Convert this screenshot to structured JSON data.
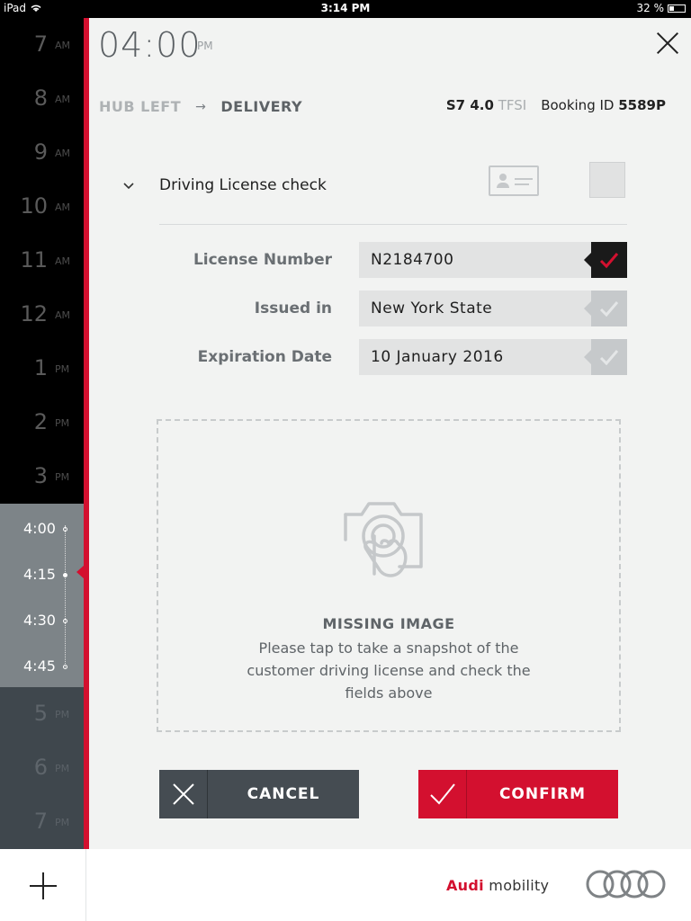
{
  "status_bar": {
    "device": "iPad",
    "time": "3:14 PM",
    "battery": "32 %"
  },
  "timeline": {
    "hours_before": [
      {
        "num": "7",
        "ampm": "AM"
      },
      {
        "num": "8",
        "ampm": "AM"
      },
      {
        "num": "9",
        "ampm": "AM"
      },
      {
        "num": "10",
        "ampm": "AM"
      },
      {
        "num": "11",
        "ampm": "AM"
      },
      {
        "num": "12",
        "ampm": "AM"
      },
      {
        "num": "1",
        "ampm": "PM"
      },
      {
        "num": "2",
        "ampm": "PM"
      },
      {
        "num": "3",
        "ampm": "PM"
      }
    ],
    "slots": [
      "4:00",
      "4:15",
      "4:30",
      "4:45"
    ],
    "hours_after": [
      {
        "num": "5",
        "ampm": "PM"
      },
      {
        "num": "6",
        "ampm": "PM"
      },
      {
        "num": "7",
        "ampm": "PM"
      }
    ]
  },
  "header": {
    "time": "04:00",
    "ampm": "PM",
    "crumb_from": "HUB LEFT",
    "crumb_arrow": "→",
    "crumb_to": "DELIVERY",
    "car_model": "S7 4.0",
    "car_engine": "TFSI",
    "booking_label": "Booking ID",
    "booking_id": "5589P"
  },
  "section": {
    "title": "Driving License check"
  },
  "fields": [
    {
      "label": "License Number",
      "value": "N2184700",
      "checked": true
    },
    {
      "label": "Issued in",
      "value": "New York State",
      "checked": false
    },
    {
      "label": "Expiration Date",
      "value": "10 January 2016",
      "checked": false
    }
  ],
  "photo": {
    "title": "MISSING IMAGE",
    "text": "Please tap to take a snapshot of the customer driving license and check the fields above"
  },
  "actions": {
    "cancel": "CANCEL",
    "confirm": "CONFIRM"
  },
  "footer": {
    "brand_audi": "Audi",
    "brand_rest": " mobility"
  },
  "colors": {
    "accent": "#d3102f",
    "dark": "#454c52",
    "panel": "#f2f3f2"
  }
}
